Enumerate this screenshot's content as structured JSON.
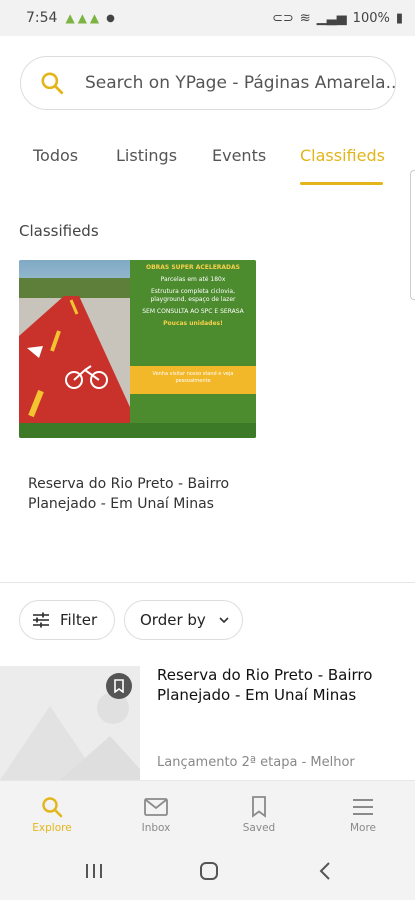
{
  "status_bar": {
    "time": "7:54",
    "battery": "100%"
  },
  "search": {
    "placeholder": "Search on YPage - Páginas Amarela..."
  },
  "tabs": [
    {
      "label": "Todos"
    },
    {
      "label": "Listings"
    },
    {
      "label": "Events"
    },
    {
      "label": "Classifieds",
      "active": true
    }
  ],
  "classifieds": {
    "section_title": "Classifieds",
    "card": {
      "caption": "Reserva do Rio Preto - Bairro Planejado - Em Unaí Minas",
      "ad_text": {
        "line1": "OBRAS SUPER ACELERADAS",
        "line2": "Parcelas em até 180x",
        "line3": "Estrutura completa ciclovia, playground, espaço de lazer",
        "line4": "SEM CONSULTA AO SPC E SERASA",
        "line5": "Poucas unidades!",
        "line6": "Venha visitar nosso stand e veja pessoalmente"
      }
    }
  },
  "filters": {
    "filter_label": "Filter",
    "order_label": "Order by"
  },
  "listing": {
    "title": "Reserva do Rio Preto - Bairro Planejado - Em Unaí Minas",
    "description": "Lançamento 2ª etapa - Melhor"
  },
  "bottom_nav": [
    {
      "label": "Explore",
      "icon": "search-icon",
      "active": true
    },
    {
      "label": "Inbox",
      "icon": "mail-icon"
    },
    {
      "label": "Saved",
      "icon": "bookmark-icon"
    },
    {
      "label": "More",
      "icon": "menu-icon"
    }
  ],
  "colors": {
    "accent": "#e2b61a",
    "ad_green": "#4c8b2e",
    "ad_yellow": "#f2b82a",
    "bikeway_red": "#c8322a"
  }
}
